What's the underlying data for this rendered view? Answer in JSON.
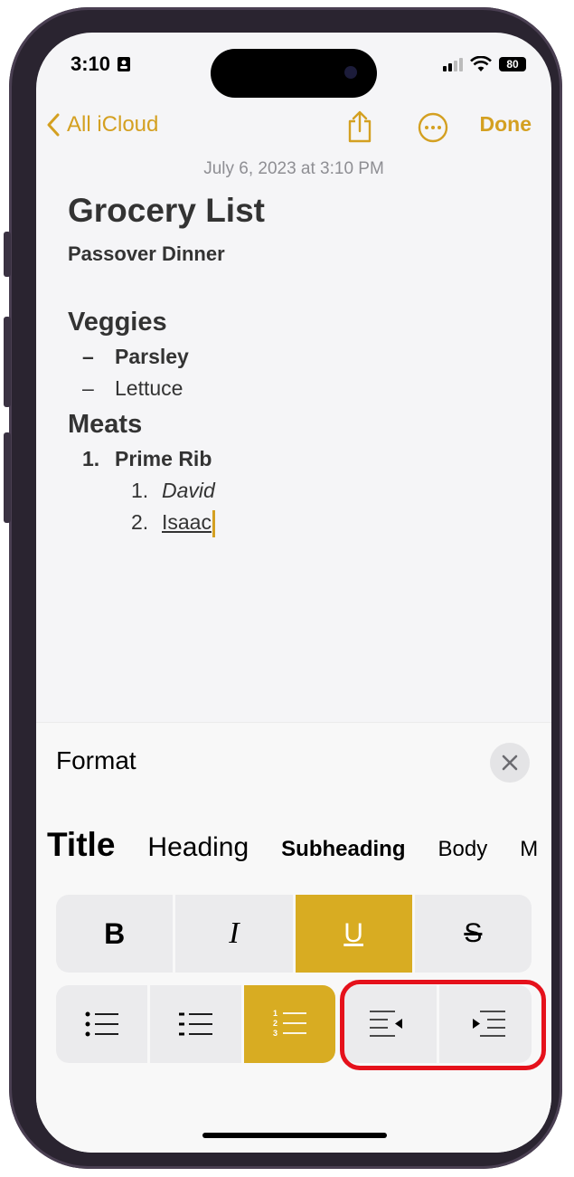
{
  "status": {
    "time": "3:10",
    "battery": "80"
  },
  "nav": {
    "back_label": "All iCloud",
    "done_label": "Done"
  },
  "note": {
    "date": "July 6, 2023 at 3:10 PM",
    "title": "Grocery List",
    "subtitle": "Passover Dinner",
    "sections": [
      {
        "heading": "Veggies",
        "items": [
          {
            "marker": "–",
            "text": "Parsley"
          },
          {
            "marker": "–",
            "text": "Lettuce"
          }
        ]
      },
      {
        "heading": "Meats",
        "items": [
          {
            "marker": "1.",
            "text": "Prime Rib"
          }
        ],
        "subitems": [
          {
            "marker": "1.",
            "text": "David"
          },
          {
            "marker": "2.",
            "text": "Isaac"
          }
        ]
      }
    ]
  },
  "format": {
    "title": "Format",
    "styles": [
      "Title",
      "Heading",
      "Subheading",
      "Body",
      "M"
    ],
    "text_buttons": [
      "B",
      "I",
      "U",
      "S"
    ],
    "list_buttons": [
      "bulleted-list",
      "dashed-list",
      "numbered-list"
    ],
    "indent_buttons": [
      "decrease-indent",
      "increase-indent"
    ],
    "selected": [
      "underline",
      "numbered-list"
    ],
    "accent_color": "#d8ac22",
    "highlight_color": "#e5111b"
  }
}
